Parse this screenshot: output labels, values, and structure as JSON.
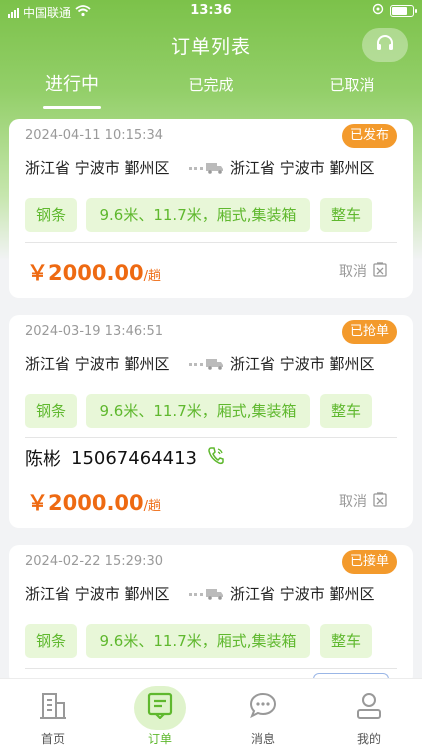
{
  "status_bar": {
    "carrier": "中国联通",
    "time": "13:36"
  },
  "nav": {
    "title": "订单列表",
    "support_icon": "headset-icon"
  },
  "tabs": [
    {
      "label": "进行中",
      "active": true
    },
    {
      "label": "已完成",
      "active": false
    },
    {
      "label": "已取消",
      "active": false
    }
  ],
  "orders": [
    {
      "time": "2024-04-11 10:15:34",
      "status": "已发布",
      "from": "浙江省 宁波市 鄞州区",
      "to": "浙江省 宁波市 鄞州区",
      "tags": [
        "钢条",
        "9.6米、11.7米，厢式,集装箱",
        "整车"
      ],
      "price": "￥2000.00",
      "price_unit": "/趟",
      "cancel": "取消"
    },
    {
      "time": "2024-03-19 13:46:51",
      "status": "已抢单",
      "from": "浙江省 宁波市 鄞州区",
      "to": "浙江省 宁波市 鄞州区",
      "tags": [
        "钢条",
        "9.6米、11.7米，厢式,集装箱",
        "整车"
      ],
      "contact_name": "陈彬",
      "contact_phone": "15067464413",
      "price": "￥2000.00",
      "price_unit": "/趟",
      "cancel": "取消"
    },
    {
      "time": "2024-02-22 15:29:30",
      "status": "已接单",
      "from": "浙江省 宁波市 鄞州区",
      "to": "浙江省 宁波市 鄞州区",
      "tags": [
        "钢条",
        "9.6米、11.7米，厢式,集装箱",
        "整车"
      ]
    }
  ],
  "bottom_nav": [
    {
      "label": "首页",
      "icon": "building-icon"
    },
    {
      "label": "订单",
      "icon": "order-list-icon",
      "active": true
    },
    {
      "label": "消息",
      "icon": "message-icon"
    },
    {
      "label": "我的",
      "icon": "user-icon"
    }
  ],
  "colors": {
    "primary": "#7cc24a",
    "accent": "#f39a2c",
    "price": "#ee6a12",
    "tag_bg": "#e8f7d8",
    "tag_text": "#5fb82e"
  }
}
